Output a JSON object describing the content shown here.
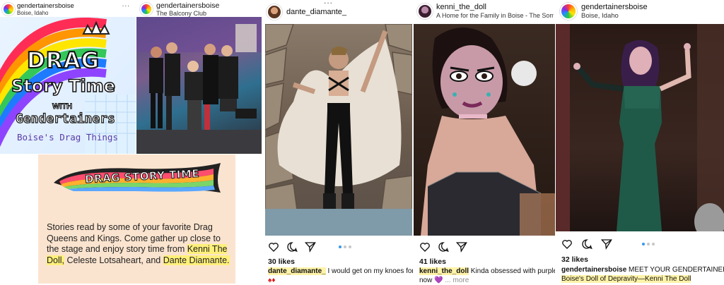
{
  "post1": {
    "username": "gendertainersboise",
    "location": "Boise, Idaho",
    "more": "...",
    "graphic": {
      "line1": "DRAG",
      "line2": "Story Time",
      "line3": "WITH",
      "line4": "Gendertainers",
      "line5": "Boise's Drag Things"
    }
  },
  "post2": {
    "username": "gendertainersboise",
    "location": "The Balcony Club",
    "more": "..."
  },
  "flyer": {
    "banner_title": "DRAG STORY TIME",
    "body_intro": "Stories read by some of your favorite Drag Queens and Kings. Come gather up close to the stage and enjoy story time from ",
    "name1": "Kenni The Doll,",
    "name_mid": " ",
    "name2": "Celeste Lotsaheart,",
    "name_and": " and ",
    "name3": "Dante Diamante."
  },
  "post3": {
    "username": "dante_diamante_",
    "more": "...",
    "likes": "30 likes",
    "caption_user": "dante_diamante_",
    "caption_text": " I would get on my knoes for you",
    "caption_emoji": "♠♦"
  },
  "post4": {
    "username": "kenni_the_doll",
    "location": "A Home for the Family in Boise - The Somewher.",
    "likes": "41 likes",
    "caption_user": "kenni_the_doll",
    "caption_text": " Kinda obsessed with purple con",
    "caption_line2": "now",
    "caption_emoji": "💜",
    "caption_more": "... more"
  },
  "post5": {
    "username": "gendertainersboise",
    "location": "Boise, Idaho",
    "likes": "32 likes",
    "caption_user": "gendertainersboise",
    "caption_text": " MEET YOUR GENDERTAINERS:",
    "caption_line2": "Boise's Doll of Depravity—Kenni The Doll"
  },
  "icons": [
    "heart-icon",
    "comment-icon",
    "share-icon",
    "more-icon"
  ],
  "colors": {
    "carousel_active": "#3897f0",
    "highlight": "#fff3a8"
  }
}
